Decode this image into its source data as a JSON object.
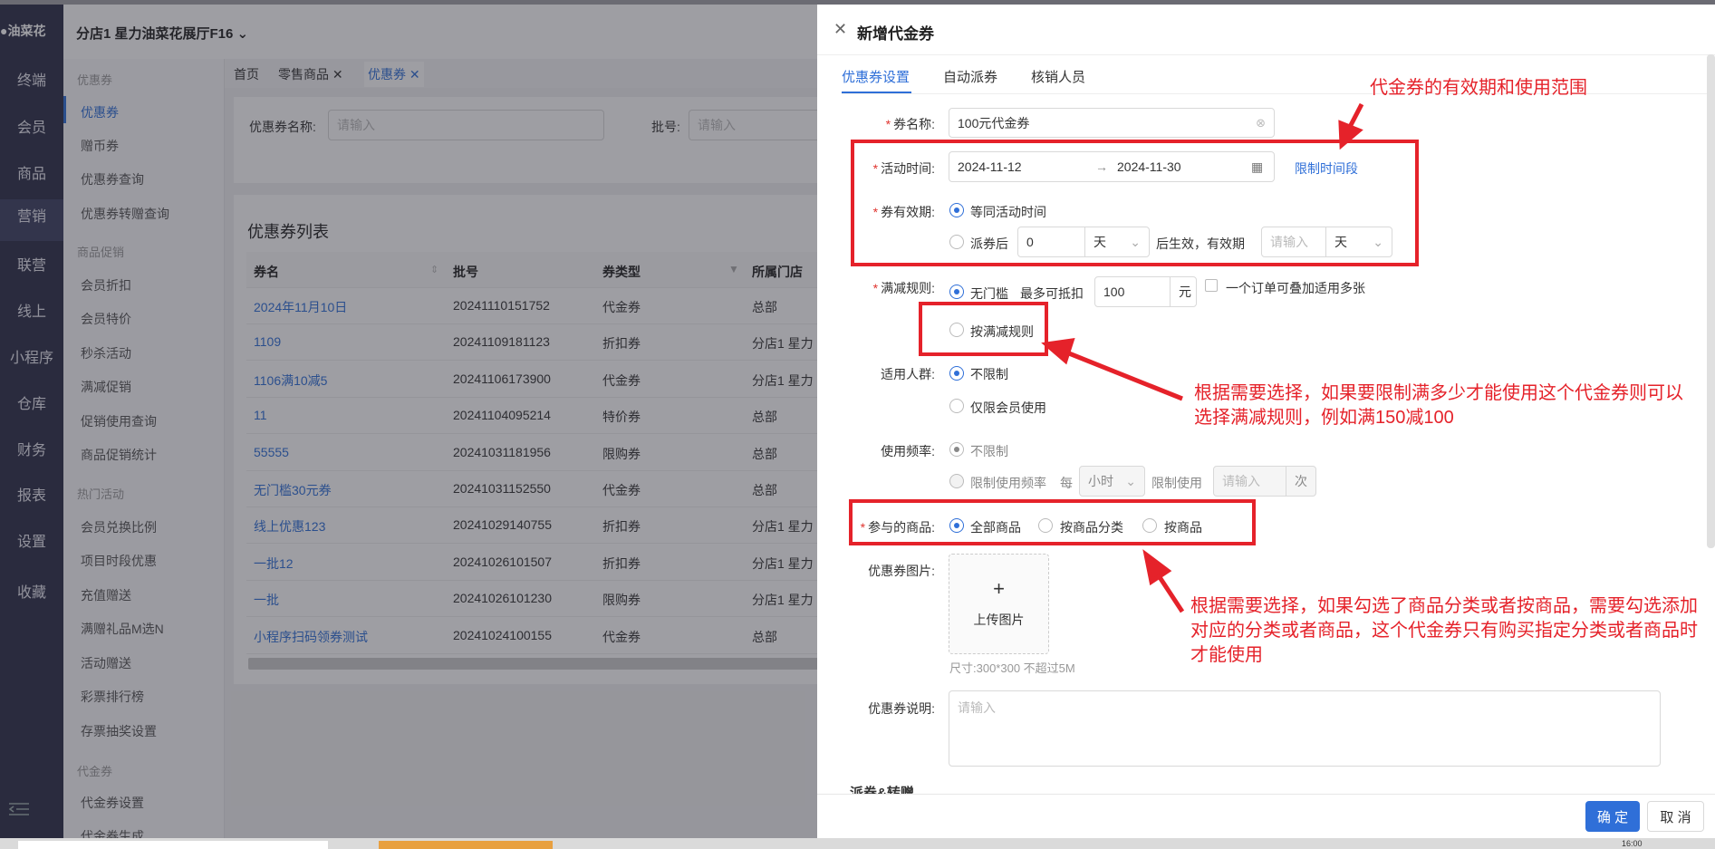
{
  "brand": "油菜花",
  "leftnav": [
    "终端",
    "会员",
    "商品",
    "营销",
    "联营",
    "线上",
    "小程序",
    "仓库",
    "财务",
    "报表",
    "设置",
    "收藏"
  ],
  "store": "分店1 星力油菜花展厅F16",
  "submenu": {
    "g1": "优惠券",
    "g1_items": [
      "优惠券",
      "赠币券",
      "优惠券查询",
      "优惠券转赠查询"
    ],
    "g2": "商品促销",
    "g2_items": [
      "会员折扣",
      "会员特价",
      "秒杀活动",
      "满减促销",
      "促销使用查询",
      "商品促销统计"
    ],
    "g3": "热门活动",
    "g3_items": [
      "会员兑换比例",
      "项目时段优惠",
      "充值赠送",
      "满赠礼品M选N",
      "活动赠送",
      "彩票排行榜",
      "存票抽奖设置"
    ],
    "g4": "代金券",
    "g4_items": [
      "代金券设置",
      "代金券生成"
    ]
  },
  "pagetabs": [
    "首页",
    "零售商品",
    "优惠券"
  ],
  "search": {
    "name_label": "优惠券名称:",
    "name_ph": "请输入",
    "batch_label": "批号:",
    "batch_ph": "请输入"
  },
  "list": {
    "title": "优惠券列表",
    "headers": [
      "券名",
      "批号",
      "券类型",
      "所属门店"
    ],
    "rows": [
      [
        "2024年11月10日",
        "20241110151752",
        "代金券",
        "总部"
      ],
      [
        "1109",
        "20241109181123",
        "折扣券",
        "分店1 星力"
      ],
      [
        "1106满10减5",
        "20241106173900",
        "代金券",
        "分店1 星力"
      ],
      [
        "11",
        "20241104095214",
        "特价券",
        "总部"
      ],
      [
        "55555",
        "20241031181956",
        "限购券",
        "总部"
      ],
      [
        "无门槛30元券",
        "20241031152550",
        "代金券",
        "总部"
      ],
      [
        "线上优惠123",
        "20241029140755",
        "折扣券",
        "分店1 星力"
      ],
      [
        "一批12",
        "20241026101507",
        "折扣券",
        "分店1 星力"
      ],
      [
        "一批",
        "20241026101230",
        "限购券",
        "分店1 星力"
      ],
      [
        "小程序扫码领券测试",
        "20241024100155",
        "代金券",
        "总部"
      ]
    ]
  },
  "drawer": {
    "title": "新增代金券",
    "tabs": [
      "优惠券设置",
      "自动派券",
      "核销人员"
    ],
    "name_label": "券名称:",
    "name_value": "100元代金券",
    "time_label": "活动时间:",
    "date_start": "2024-11-12",
    "date_end": "2024-11-30",
    "limit_link": "限制时间段",
    "valid_label": "券有效期:",
    "valid_opt1": "等同活动时间",
    "valid_opt2": "派券后",
    "valid_days": "0",
    "unit_day": "天",
    "valid_mid": "后生效，有效期",
    "valid_ph": "请输入",
    "rule_label": "满减规则:",
    "rule_opt1": "无门槛",
    "rule_max": "最多可抵扣",
    "rule_amount": "100",
    "rule_unit": "元",
    "rule_stack": "一个订单可叠加适用多张",
    "rule_opt2": "按满减规则",
    "crowd_label": "适用人群:",
    "crowd_opt1": "不限制",
    "crowd_opt2": "仅限会员使用",
    "freq_label": "使用频率:",
    "freq_opt1": "不限制",
    "freq_opt2": "限制使用频率",
    "freq_each": "每",
    "freq_unit": "小时",
    "freq_limit": "限制使用",
    "freq_ph": "请输入",
    "freq_times": "次",
    "goods_label": "参与的商品:",
    "goods_opt1": "全部商品",
    "goods_opt2": "按商品分类",
    "goods_opt3": "按商品",
    "image_label": "优惠券图片:",
    "upload_plus": "+",
    "upload_text": "上传图片",
    "image_hint": "尺寸:300*300 不超过5M",
    "desc_label": "优惠券说明:",
    "desc_ph": "请输入",
    "section_cut": "派券&转赠",
    "ok": "确 定",
    "cancel": "取 消"
  },
  "notes": {
    "n1": "代金券的有效期和使用范围",
    "n2": "根据需要选择，如果要限制满多少才能使用这个代金券则可以选择满减规则，例如满150减100",
    "n3": "根据需要选择，如果勾选了商品分类或者按商品，需要勾选添加对应的分类或者商品，这个代金券只有购买指定分类或者商品时才能使用"
  },
  "clock": "16:00",
  "colors": {
    "accent": "#2f6fd8",
    "annotation": "#e5222a",
    "nav": "#2c2f48"
  }
}
